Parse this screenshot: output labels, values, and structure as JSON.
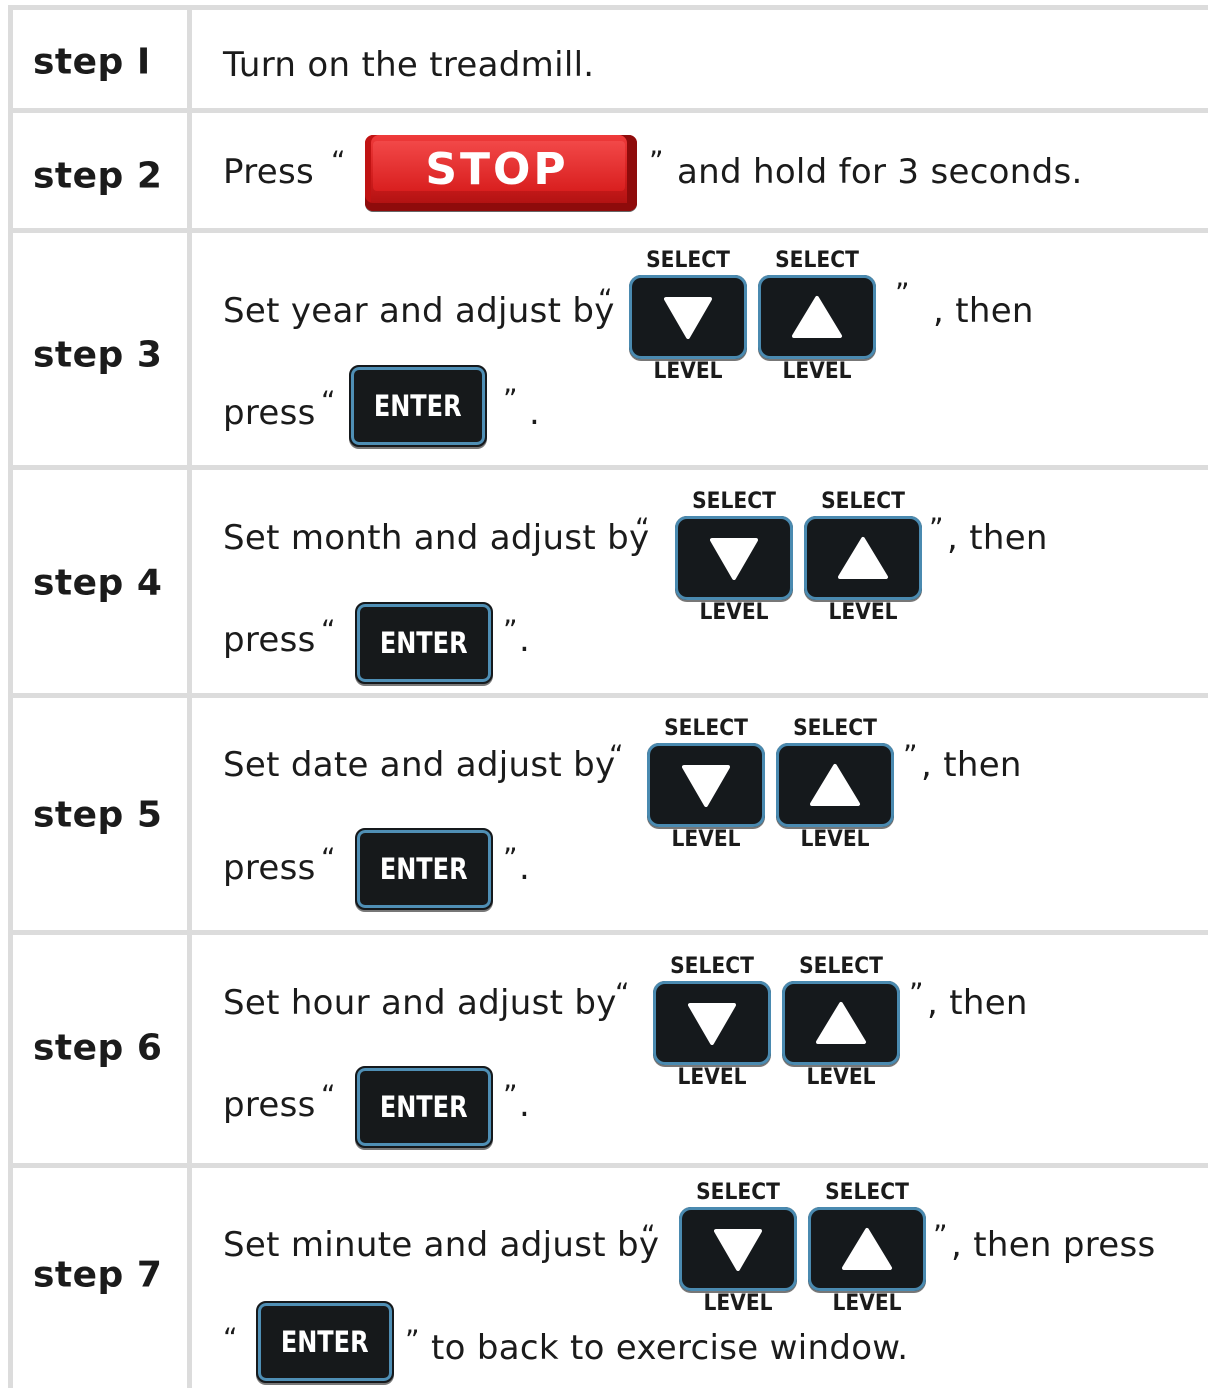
{
  "steps": [
    {
      "label": "step I",
      "text": "Turn on the treadmill."
    },
    {
      "label": "step 2",
      "text_before": "Press",
      "text_after": "and hold for 3 seconds.",
      "button": "STOP"
    },
    {
      "label": "step 3",
      "line1": "Set year and adjust by",
      "line1_end": ", then",
      "line2": "press",
      "line2_end": "."
    },
    {
      "label": "step 4",
      "line1": "Set month and adjust by",
      "line1_end": ", then",
      "line2": "press",
      "line2_end": "."
    },
    {
      "label": "step 5",
      "line1": "Set date and adjust by",
      "line1_end": ", then",
      "line2": "press",
      "line2_end": "."
    },
    {
      "label": "step 6",
      "line1": "Set hour and adjust by",
      "line1_end": ", then",
      "line2": "press",
      "line2_end": "."
    },
    {
      "label": "step 7",
      "line1": "Set minute and adjust by",
      "line1_end": ", then press",
      "line2_end": "to back to exercise window."
    }
  ],
  "buttons": {
    "enter": "ENTER",
    "select": "SELECT",
    "level": "LEVEL",
    "open_quote": "“",
    "close_quote": "”",
    "down_icon": "down-triangle",
    "up_icon": "up-triangle"
  },
  "colors": {
    "stop_red": "#d21e1e",
    "key_dark": "#15191c",
    "key_outline": "#4a8ab0",
    "divider": "#dcdcdc"
  }
}
